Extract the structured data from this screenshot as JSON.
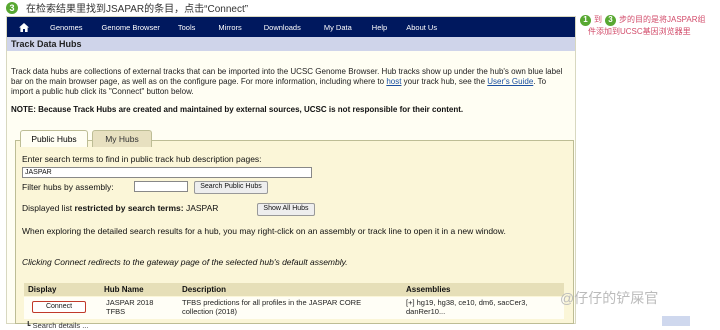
{
  "step": {
    "number": "3",
    "text": "在检索结果里找到JSAPAR的条目，点击“Connect”"
  },
  "navbar": {
    "items": [
      "Genomes",
      "Genome Browser",
      "Tools",
      "Mirrors",
      "Downloads",
      "My Data",
      "Help",
      "About Us"
    ]
  },
  "title": "Track Data Hubs",
  "intro": {
    "part1": "Track data hubs are collections of external tracks that can be imported into the UCSC Genome Browser. Hub tracks show up under the hub's own blue label bar on the main browser page, as well as on the configure page. For more information, including where to ",
    "link_host": "host",
    "part2": " your track hub, see the ",
    "link_guide": "User's Guide",
    "part3": ". To import a public hub click its \"Connect\" button below."
  },
  "note": "NOTE: Because Track Hubs are created and maintained by external sources, UCSC is not responsible for their content.",
  "tabs": {
    "public": "Public Hubs",
    "my": "My Hubs"
  },
  "search": {
    "prompt": "Enter search terms to find in public track hub description pages:",
    "value": "JASPAR",
    "filter_label": "Filter hubs by assembly:",
    "filter_value": "",
    "search_button": "Search Public Hubs"
  },
  "displayed": {
    "prefix": "Displayed list ",
    "bold": "restricted by search terms:",
    "term": " JASPAR",
    "show_all_button": "Show All Hubs"
  },
  "explore_text": "When exploring the detailed search results for a hub, you may right-click on an assembly or track line to open it in a new window.",
  "redirect_text": "Clicking Connect redirects to the gateway page of the selected hub's default assembly.",
  "table": {
    "headers": [
      "Display",
      "Hub Name",
      "Description",
      "Assemblies"
    ],
    "row": {
      "button": "Connect",
      "hub_name": "JASPAR 2018 TFBS",
      "description": "TFBS predictions for all profiles in the JASPAR CORE collection (2018)",
      "assemblies": "[+] hg19, hg38, ce10, dm6, sacCer3, danRer10..."
    },
    "search_details": "Search details ..."
  },
  "annotation": {
    "num1": "1",
    "to": "到",
    "num3": "3",
    "line1": "步的目的是将JASPAR组",
    "line2": "件添加到UCSC基因浏览器里"
  },
  "watermark": "@仔仔的铲屎官",
  "colors": {
    "navbar": "#00185e",
    "titlebar": "#cfd4ea",
    "accent_green": "#58a832",
    "annotation": "#d24b6a",
    "connect_outline": "#c0392b"
  }
}
